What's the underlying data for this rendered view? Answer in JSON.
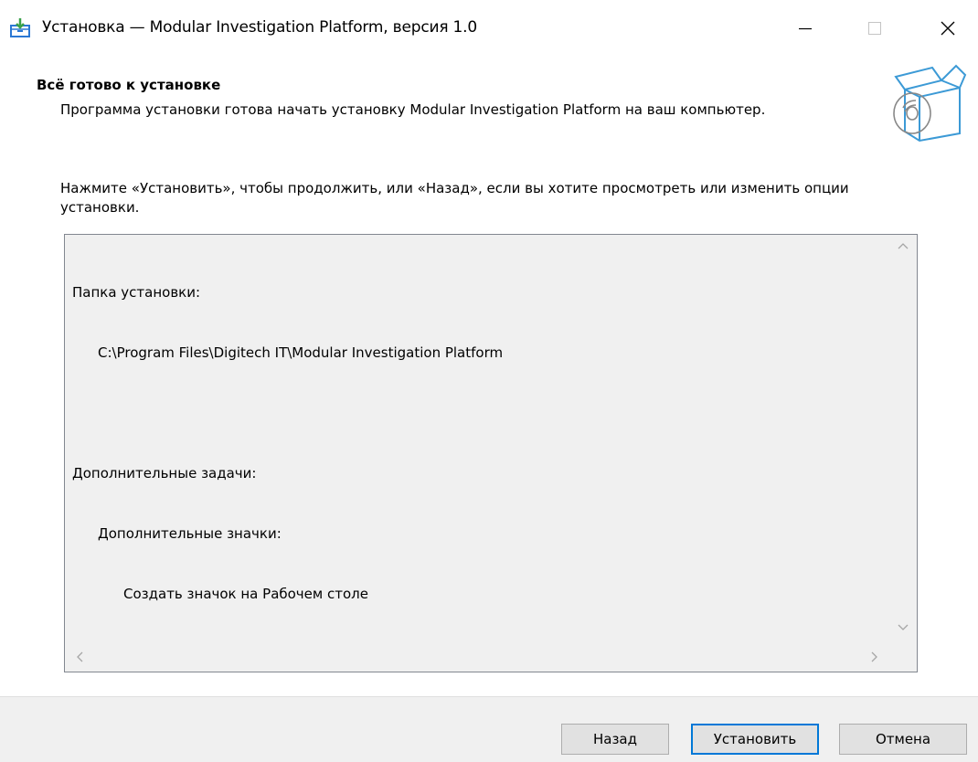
{
  "window": {
    "title": "Установка — Modular Investigation Platform, версия 1.0"
  },
  "header": {
    "title": "Всё готово к установке",
    "subtitle": "Программа установки готова начать установку Modular Investigation Platform на ваш компьютер."
  },
  "instruction": "Нажмите «Установить», чтобы продолжить, или «Назад», если вы хотите просмотреть или изменить опции установки.",
  "memo": {
    "install_folder_label": "Папка установки:",
    "install_folder_path": "C:\\Program Files\\Digitech IT\\Modular Investigation Platform",
    "tasks_label": "Дополнительные задачи:",
    "tasks_group": "Дополнительные значки:",
    "tasks_item": "Создать значок на Рабочем столе"
  },
  "buttons": {
    "back": "Назад",
    "install": "Установить",
    "cancel": "Отмена"
  },
  "colors": {
    "accent": "#0078d7",
    "memo_bg": "#f0f0f0",
    "footer_bg": "#f0f0f0"
  }
}
